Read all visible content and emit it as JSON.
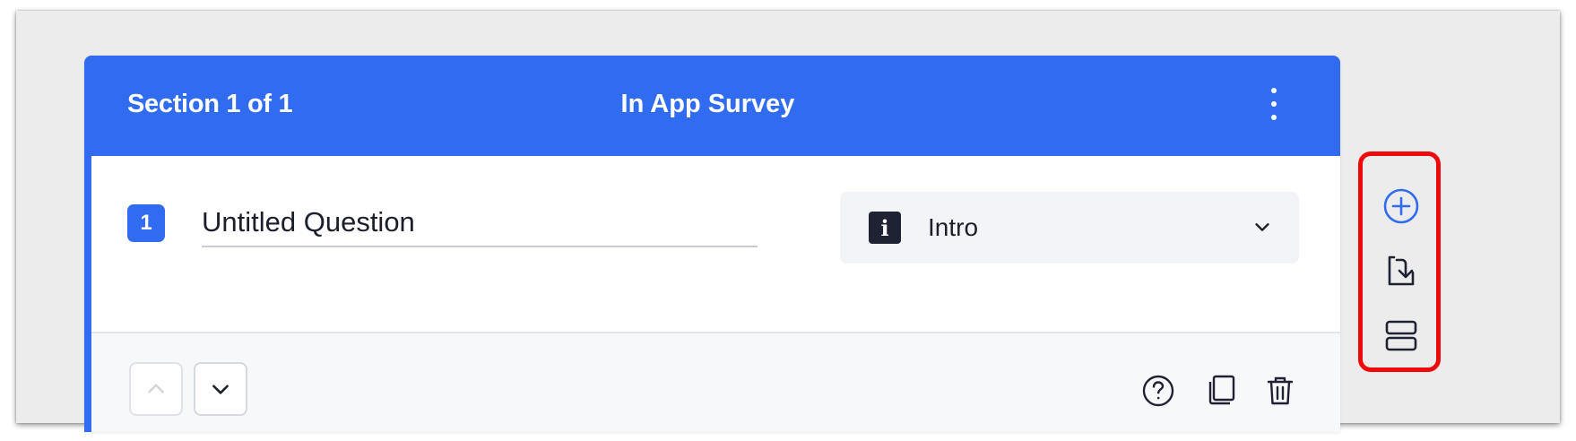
{
  "header": {
    "section_label": "Section 1 of 1",
    "survey_title": "In App Survey"
  },
  "question": {
    "number": "1",
    "title_value": "Untitled Question",
    "type": {
      "label": "Intro",
      "icon_glyph": "i"
    }
  },
  "icons": {
    "header_menu": "more-vertical-icon",
    "type_icon": "info-icon",
    "dropdown": "chevron-down-icon",
    "move_up": "chevron-up-icon",
    "move_down": "chevron-down-icon",
    "help": "help-circle-icon",
    "duplicate": "copy-icon",
    "delete": "trash-icon",
    "add_question": "plus-circle-icon",
    "import_questions": "import-icon",
    "add_section": "section-icon"
  },
  "colors": {
    "primary": "#316bef",
    "highlight_border": "#ee0a0a",
    "background": "#ececec",
    "text_dark": "#1c1f2a"
  }
}
